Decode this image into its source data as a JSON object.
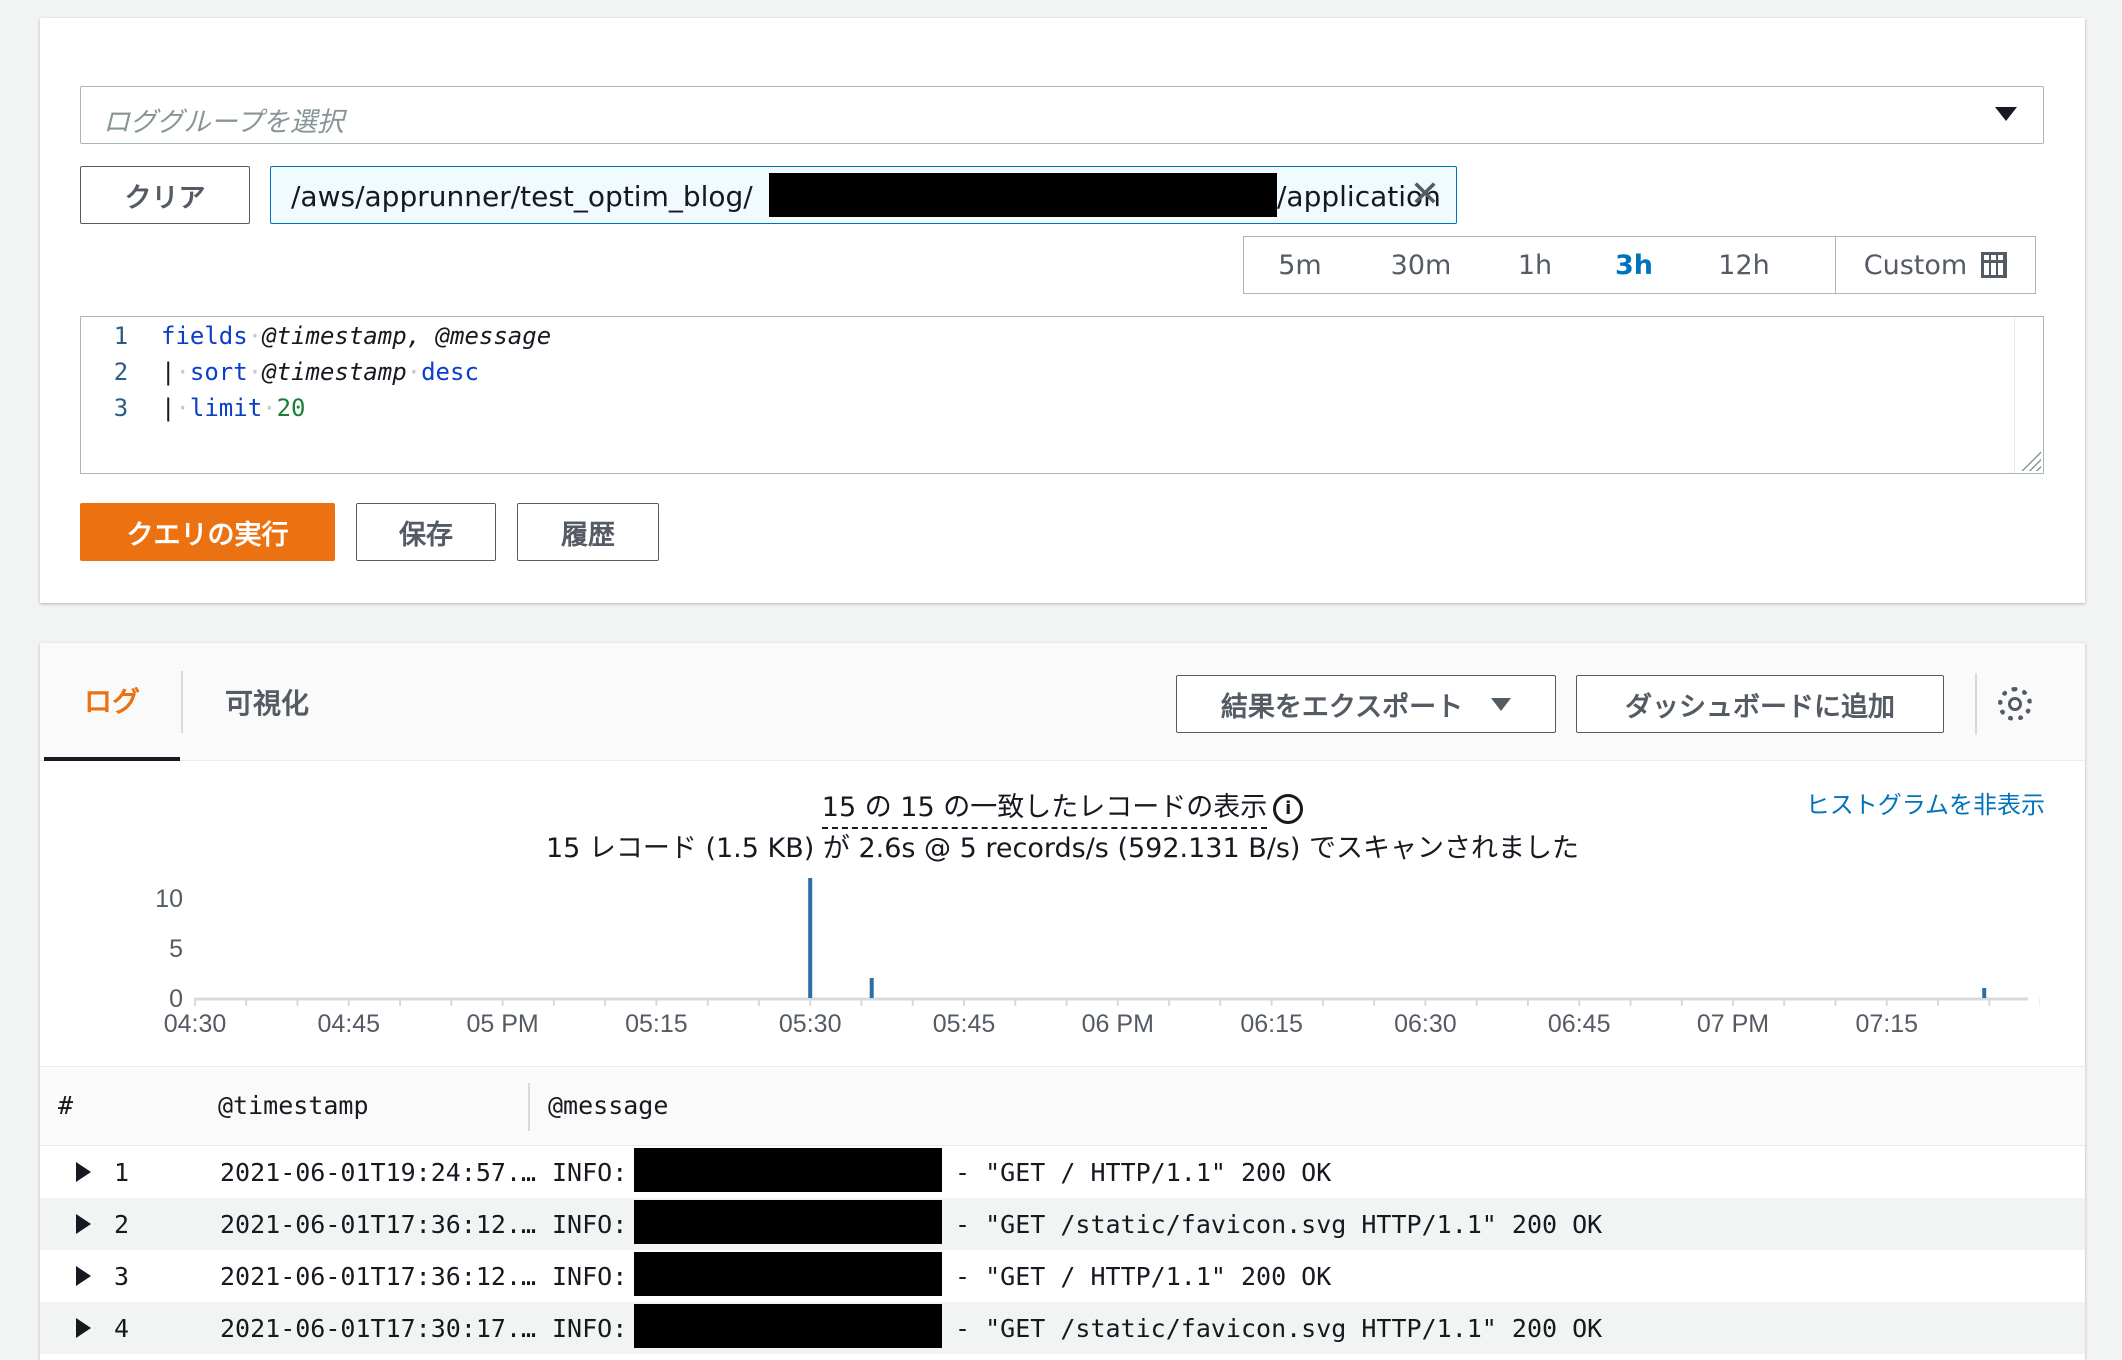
{
  "query_panel": {
    "log_group_placeholder": "ロググループを選択",
    "clear_label": "クリア",
    "log_group_token": {
      "prefix": "/aws/apprunner/test_optim_blog/",
      "suffix": "/application",
      "remove_icon": "close-icon"
    },
    "time_range": {
      "options": [
        "5m",
        "30m",
        "1h",
        "3h",
        "12h"
      ],
      "selected": "3h",
      "custom_label": "Custom",
      "custom_icon": "calendar-icon"
    },
    "editor": {
      "lines": [
        {
          "number": "1",
          "keyword": "fields",
          "rest": "@timestamp, @message"
        },
        {
          "number": "2",
          "pipe": "|",
          "keyword": "sort",
          "field": "@timestamp",
          "keyword2": "desc"
        },
        {
          "number": "3",
          "pipe": "|",
          "keyword": "limit",
          "value": "20"
        }
      ]
    },
    "run_label": "クエリの実行",
    "save_label": "保存",
    "history_label": "履歴"
  },
  "results_panel": {
    "tabs": [
      {
        "label": "ログ",
        "active": true
      },
      {
        "label": "可視化",
        "active": false
      }
    ],
    "export_label": "結果をエクスポート",
    "dashboard_label": "ダッシュボードに追加",
    "settings_icon": "gear-icon",
    "summary_line1": "15 の 15 の一致したレコードの表示",
    "summary_line2": "15 レコード (1.5 KB) が 2.6s @ 5 records/s (592.131 B/s) でスキャンされました",
    "hide_histogram_label": "ヒストグラムを非表示",
    "table": {
      "headers": [
        "#",
        "@timestamp",
        "@message"
      ],
      "rows": [
        {
          "num": "1",
          "timestamp": "2021-06-01T19:24:57.…",
          "level": "INFO:",
          "message": "- \"GET / HTTP/1.1\" 200 OK"
        },
        {
          "num": "2",
          "timestamp": "2021-06-01T17:36:12.…",
          "level": "INFO:",
          "message": "- \"GET /static/favicon.svg HTTP/1.1\" 200 OK"
        },
        {
          "num": "3",
          "timestamp": "2021-06-01T17:36:12.…",
          "level": "INFO:",
          "message": "- \"GET / HTTP/1.1\" 200 OK"
        },
        {
          "num": "4",
          "timestamp": "2021-06-01T17:30:17.…",
          "level": "INFO:",
          "message": "- \"GET /static/favicon.svg HTTP/1.1\" 200 OK"
        }
      ]
    }
  },
  "chart_data": {
    "type": "bar",
    "x_tick_labels": [
      "04:30",
      "04:45",
      "05 PM",
      "05:15",
      "05:30",
      "05:45",
      "06 PM",
      "06:15",
      "06:30",
      "06:45",
      "07 PM",
      "07:15"
    ],
    "x_range_minutes": [
      0,
      180
    ],
    "y_ticks": [
      0,
      5,
      10
    ],
    "ylim": [
      0,
      11
    ],
    "bars": [
      {
        "x_minutes": 60,
        "time": "05:30",
        "value": 12
      },
      {
        "x_minutes": 66,
        "time": "05:36",
        "value": 2
      },
      {
        "x_minutes": 174.5,
        "time": "07:24",
        "value": 1
      }
    ],
    "bar_color": "#2e6da4",
    "axis_color": "#d5dbdb"
  }
}
